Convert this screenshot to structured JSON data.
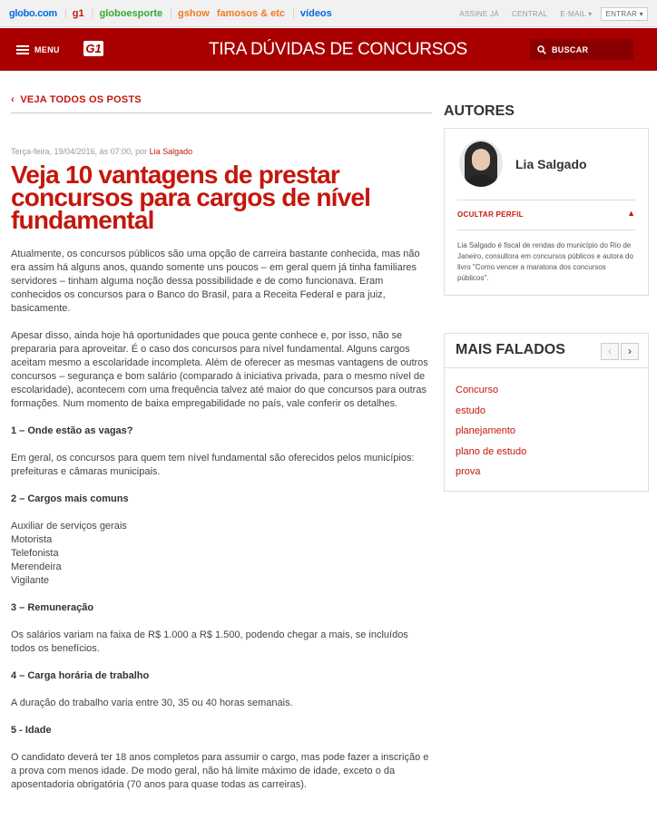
{
  "globobar": {
    "links": [
      "globo.com",
      "g1",
      "globoesporte",
      "gshow",
      "famosos & etc",
      "vídeos"
    ],
    "right": {
      "assine": "ASSINE JÁ",
      "central": "CENTRAL",
      "email": "E-MAIL",
      "entrar": "ENTRAR"
    }
  },
  "header": {
    "menu_label": "MENU",
    "logo_text": "G1",
    "title": "TIRA DÚVIDAS DE CONCURSOS",
    "search_label": "BUSCAR"
  },
  "back_link": "VEJA TODOS OS POSTS",
  "meta": {
    "date": "Terça-feira, 19/04/2016, às 07:00, por ",
    "author": "Lia Salgado"
  },
  "article": {
    "title": "Veja 10 vantagens de prestar concursos para cargos de nível fundamental",
    "paragraphs": [
      "Atualmente, os concursos públicos são uma opção de carreira bastante conhecida, mas não era assim há alguns anos, quando somente uns poucos – em geral quem já tinha familiares servidores – tinham alguma noção dessa possibilidade e de como funcionava. Eram conhecidos os concursos para o Banco do Brasil, para a Receita Federal e para juiz, basicamente.",
      "Apesar disso, ainda hoje há oportunidades que pouca gente conhece e, por isso, não se prepararia para aproveitar. É o caso dos concursos para nível fundamental. Alguns cargos aceitam mesmo a escolaridade incompleta. Além de oferecer as mesmas vantagens de outros concursos – segurança e bom salário (comparado à iniciativa privada, para o mesmo nível de escolaridade), acontecem com uma frequência talvez até maior do que concursos para outras formações. Num momento de baixa empregabilidade no país, vale conferir os detalhes.",
      "1 – Onde estão as vagas?",
      "Em geral, os concursos para quem tem nível fundamental são oferecidos pelos municípios: prefeituras e câmaras municipais.",
      "2 – Cargos mais comuns",
      "3 – Remuneração",
      "Os salários variam na faixa de R$ 1.000 a R$ 1.500, podendo chegar a mais, se incluídos todos os benefícios.",
      "4 – Carga horária de trabalho",
      "A duração do trabalho varia entre 30, 35 ou 40 horas semanais.",
      "5 - Idade",
      "O candidato deverá ter 18 anos completos para assumir o cargo, mas pode fazer a inscrição e a prova com menos idade. De modo geral, não há limite máximo de idade, exceto o da aposentadoria obrigatória (70 anos para quase todas as carreiras)."
    ],
    "cargos": [
      "Auxiliar de serviços gerais",
      "Motorista",
      "Telefonista",
      "Merendeira",
      "Vigilante"
    ]
  },
  "sidebar": {
    "autores_heading": "AUTORES",
    "author_name": "Lia Salgado",
    "ocultar": "OCULTAR PERFIL",
    "bio": "Lia Salgado é fiscal de rendas do município do Rio de Janeiro, consultora em concursos públicos e autora do livro \"Como vencer a maratona dos concursos públicos\".",
    "mais_heading": "MAIS FALADOS",
    "tags": [
      "Concurso",
      "estudo",
      "planejamento",
      "plano de estudo",
      "prova"
    ]
  }
}
